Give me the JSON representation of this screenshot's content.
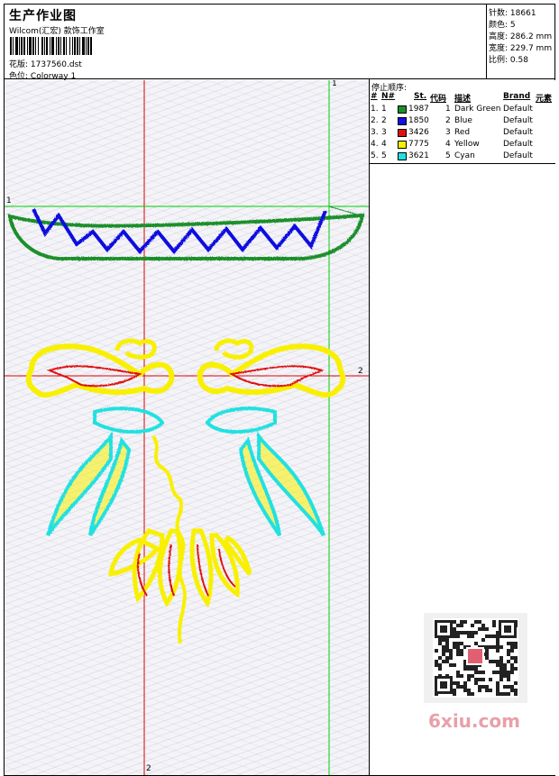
{
  "header": {
    "title": "生产作业图",
    "subtitle": "Wilcom(汇宏) 款饰工作室",
    "design_label": "花版:",
    "design_file": "1737560.dst",
    "color_label": "色位:",
    "colorway": "Colorway 1"
  },
  "stats": [
    {
      "label": "针数:",
      "value": "18661"
    },
    {
      "label": "颜色:",
      "value": "5"
    },
    {
      "label": "高度:",
      "value": "286.2 mm"
    },
    {
      "label": "宽度:",
      "value": "229.7 mm"
    },
    {
      "label": "比例:",
      "value": "0.58"
    }
  ],
  "stop_sequence": {
    "title": "停止顺序:",
    "columns": [
      "#",
      "N#",
      "St.",
      "代码",
      "描述",
      "Brand",
      "元素"
    ],
    "rows": [
      {
        "idx": "1.",
        "n": "1",
        "color": "#1a8f2a",
        "st": "1987",
        "code": "1",
        "desc": "Dark Green",
        "brand": "Default"
      },
      {
        "idx": "2.",
        "n": "2",
        "color": "#1010e0",
        "st": "1850",
        "code": "2",
        "desc": "Blue",
        "brand": "Default"
      },
      {
        "idx": "3.",
        "n": "3",
        "color": "#e01010",
        "st": "3426",
        "code": "3",
        "desc": "Red",
        "brand": "Default"
      },
      {
        "idx": "4.",
        "n": "4",
        "color": "#f8f000",
        "st": "7775",
        "code": "4",
        "desc": "Yellow",
        "brand": "Default"
      },
      {
        "idx": "5.",
        "n": "5",
        "color": "#20e0e0",
        "st": "3621",
        "code": "5",
        "desc": "Cyan",
        "brand": "Default"
      }
    ]
  },
  "guides": {
    "v1": "1",
    "v2": "2",
    "h1": "1",
    "h2": "2"
  },
  "watermark": "6xiu.com",
  "colors": {
    "guide_red": "#e00000",
    "guide_green": "#00d000",
    "dark_green": "#1a8f2a",
    "blue": "#1010e0",
    "red": "#e01010",
    "yellow": "#f8f000",
    "cyan": "#20e0e0"
  }
}
